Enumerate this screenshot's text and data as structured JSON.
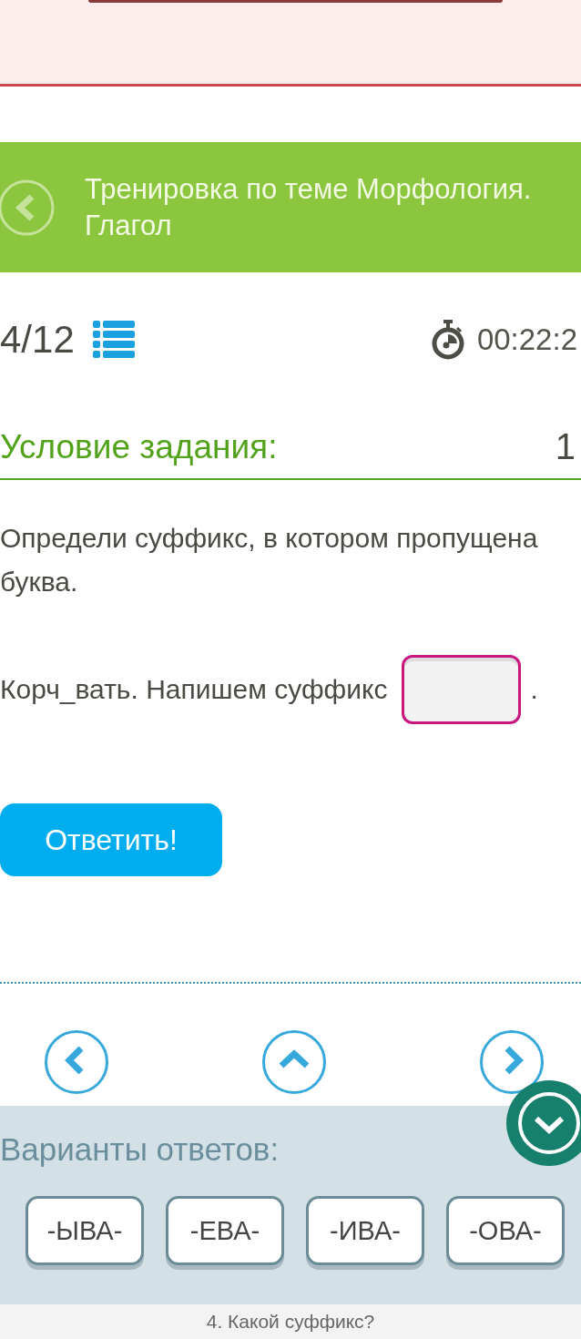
{
  "header": {
    "title": "Тренировка по теме Морфология. Глагол"
  },
  "progress": {
    "counter": "4/12",
    "timer": "00:22:2"
  },
  "task": {
    "heading": "Условие задания:",
    "points": "1",
    "text": "Определи суффикс, в котором пропущена буква.",
    "prompt": "Корч_вать. Напишем суффикс",
    "prompt_end": "."
  },
  "submit_button": {
    "label": "Ответить!"
  },
  "answers": {
    "heading": "Варианты ответов:",
    "options": [
      {
        "label": "-ЫВА-",
        "selected": false
      },
      {
        "label": "-ЕВА-",
        "selected": false
      },
      {
        "label": "-ИВА-",
        "selected": false
      },
      {
        "label": "-ОВА-",
        "selected": false
      }
    ]
  },
  "footer": {
    "caption": "4. Какой суффикс?"
  }
}
